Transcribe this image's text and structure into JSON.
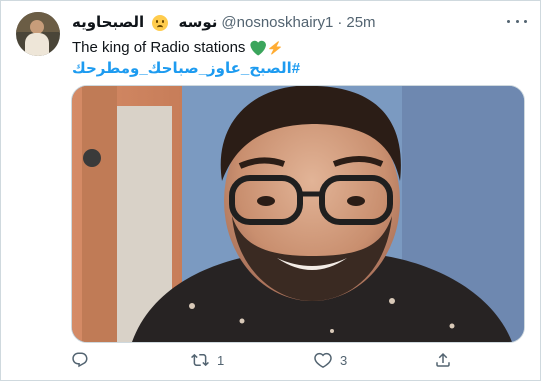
{
  "tweet": {
    "author_name": "نوسه",
    "author_name2": "الصبحاويه",
    "emoji": "sad-face",
    "handle": "@nosnoskhairy1",
    "separator": "·",
    "time": "25m",
    "text": "The king of Radio stations",
    "text_emojis": [
      "green-heart",
      "high-voltage"
    ],
    "hashtag": "#الصبح_عاوز_صباحك_ومطرحك",
    "media_alt": "photo of a smiling man with glasses and beard"
  },
  "actions": {
    "reply_count": "",
    "retweet_count": "1",
    "like_count": "3",
    "share_count": ""
  },
  "colors": {
    "accent": "#1d9bf0",
    "text": "#0f1419",
    "muted": "#536471",
    "border": "#cfd9de"
  }
}
